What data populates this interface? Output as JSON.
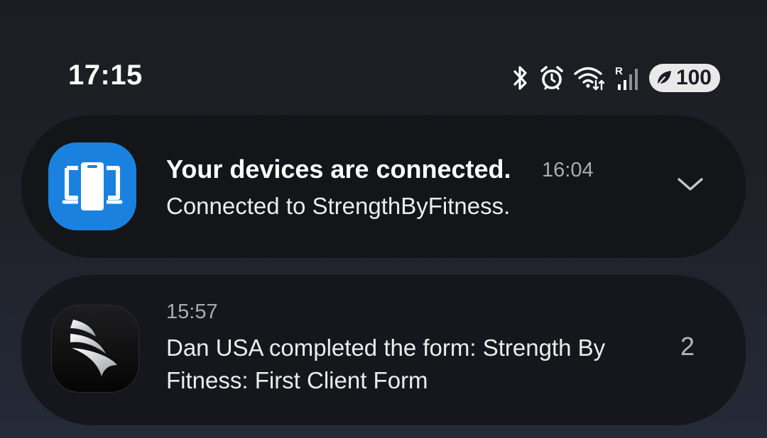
{
  "status_bar": {
    "time": "17:15",
    "battery": "100",
    "icons": [
      "bluetooth-icon",
      "alarm-icon",
      "wifi-icon",
      "signal-icon",
      "leaf-icon"
    ],
    "signal_label": "R"
  },
  "notifications": [
    {
      "app_icon": "device-link-icon",
      "title": "Your devices are connected.",
      "time": "16:04",
      "text": "Connected to StrengthByFitness.",
      "action_icon": "chevron-down-icon"
    },
    {
      "app_icon": "strength-by-fitness-logo-icon",
      "time": "15:57",
      "text": "Dan USA completed the form: Strength By Fitness: First Client Form",
      "count": "2"
    }
  ],
  "colors": {
    "background": "#1e1f25",
    "card": "#141518",
    "accent_blue": "#1a82de",
    "secondary_text": "#a9abb2"
  }
}
